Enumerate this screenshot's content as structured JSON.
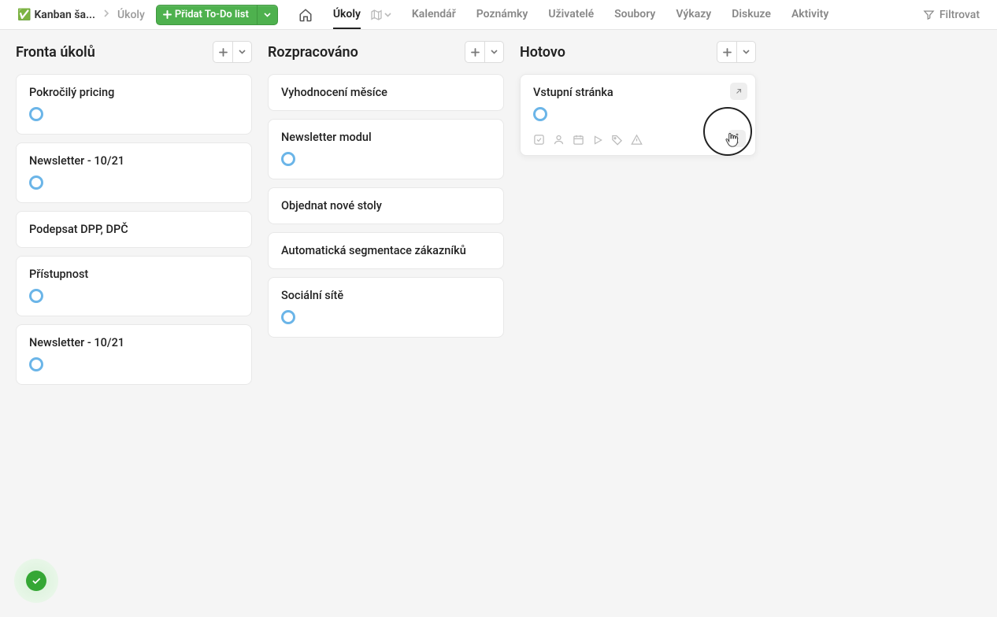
{
  "breadcrumb": {
    "icon": "✅",
    "project": "Kanban ša...",
    "sub": "Úkoly"
  },
  "addButton": {
    "label": "Přidat To-Do list"
  },
  "tabs": {
    "ukoly": "Úkoly",
    "kalendar": "Kalendář",
    "poznamky": "Poznámky",
    "uzivatele": "Uživatelé",
    "soubory": "Soubory",
    "vykazy": "Výkazy",
    "diskuze": "Diskuze",
    "aktivity": "Aktivity"
  },
  "filter": {
    "label": "Filtrovat"
  },
  "columns": {
    "c1": {
      "title": "Fronta úkolů",
      "cards": [
        {
          "title": "Pokročilý pricing",
          "ring": true
        },
        {
          "title": "Newsletter - 10/21",
          "ring": true
        },
        {
          "title": "Podepsat DPP, DPČ",
          "ring": false
        },
        {
          "title": "Přístupnost",
          "ring": true
        },
        {
          "title": "Newsletter - 10/21",
          "ring": true
        }
      ]
    },
    "c2": {
      "title": "Rozpracováno",
      "cards": [
        {
          "title": "Vyhodnocení měsíce",
          "ring": false
        },
        {
          "title": "Newsletter modul",
          "ring": true
        },
        {
          "title": "Objednat nové stoly",
          "ring": false
        },
        {
          "title": "Automatická segmentace zákazníků",
          "ring": false
        },
        {
          "title": "Sociální sítě",
          "ring": true
        }
      ]
    },
    "c3": {
      "title": "Hotovo",
      "cards": [
        {
          "title": "Vstupní stránka",
          "ring": true,
          "focused": true
        }
      ]
    }
  }
}
